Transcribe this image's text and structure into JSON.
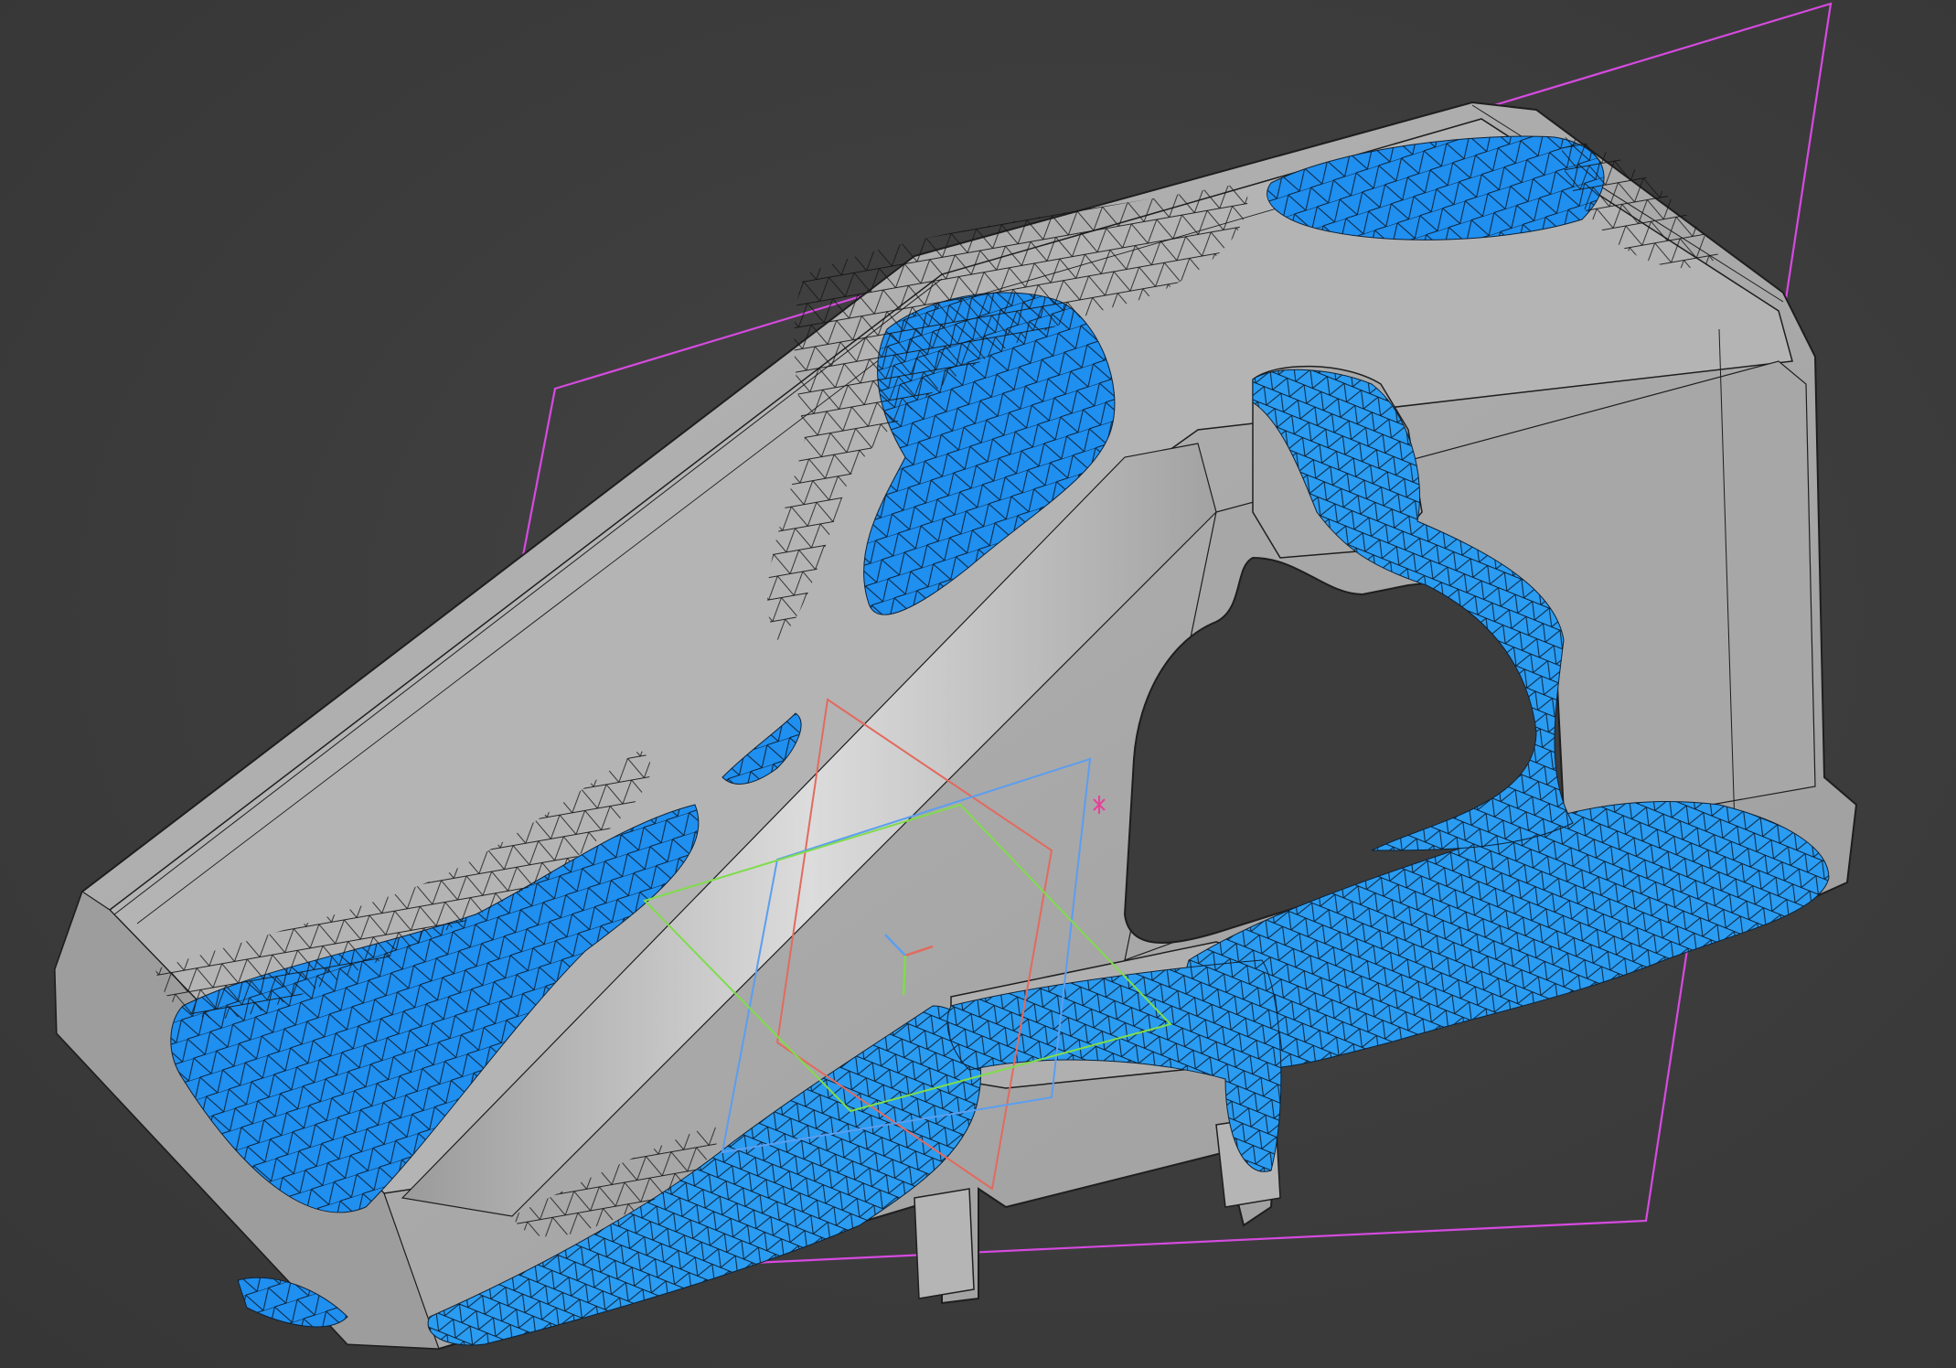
{
  "viewport": {
    "background": "#3c3c3c",
    "part_color": "#a9a9a9",
    "part_edge_color": "#1e1e1e",
    "scan_mesh_color": "#1f8ff0",
    "scan_wire_color": "#0b1a2a",
    "section_plane_color": "#d64ae0"
  },
  "gizmo": {
    "x_axis_color": "#e26a5e",
    "y_axis_color": "#7fdc4c",
    "z_axis_color": "#5b9ef0",
    "center_mark_color": "#e8409a"
  },
  "icons": {
    "triad": "axis-triad-icon",
    "center": "pivot-marker-icon"
  }
}
